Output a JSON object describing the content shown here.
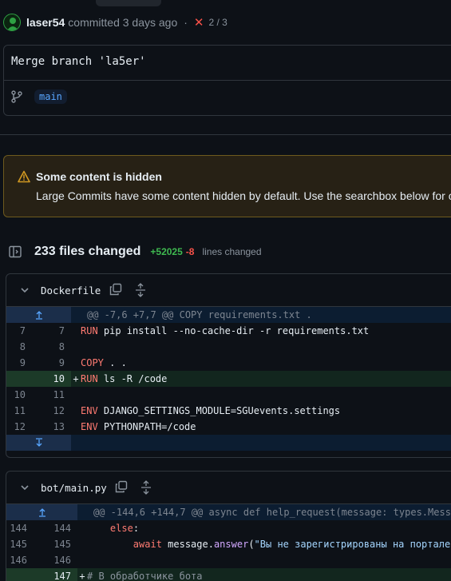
{
  "commit": {
    "author": "laser54",
    "meta": "committed 3 days ago",
    "separator": "·",
    "checks": "2 / 3",
    "message": "Merge branch 'la5er'",
    "branch": "main"
  },
  "notice": {
    "title": "Some content is hidden",
    "body": "Large Commits have some content hidden by default. Use the searchbox below for c"
  },
  "summary": {
    "files_changed": "233 files changed",
    "additions": "+52025",
    "deletions": "-8",
    "lines_changed": "lines changed"
  },
  "files": [
    {
      "name": "Dockerfile",
      "hunk": "@@ -7,6 +7,7 @@ COPY requirements.txt .",
      "lines": [
        {
          "old": "7",
          "new": "7",
          "sign": "",
          "kw": "RUN",
          "rest": " pip install --no-cache-dir -r requirements.txt"
        },
        {
          "old": "8",
          "new": "8",
          "sign": "",
          "kw": "",
          "rest": ""
        },
        {
          "old": "9",
          "new": "9",
          "sign": "",
          "kw": "COPY",
          "rest": " . ."
        },
        {
          "old": "",
          "new": "10",
          "sign": "+",
          "kw": "RUN",
          "rest": " ls -R /code"
        },
        {
          "old": "10",
          "new": "11",
          "sign": "",
          "kw": "",
          "rest": ""
        },
        {
          "old": "11",
          "new": "12",
          "sign": "",
          "kw": "ENV",
          "rest": " DJANGO_SETTINGS_MODULE=SGUevents.settings"
        },
        {
          "old": "12",
          "new": "13",
          "sign": "",
          "kw": "ENV",
          "rest": " PYTHONPATH=/code"
        }
      ]
    },
    {
      "name": "bot/main.py",
      "hunk": "@@ -144,6 +144,7 @@ async def help_request(message: types.Messa",
      "lines": [
        {
          "old": "144",
          "new": "144",
          "sign": "",
          "indent": "    ",
          "kw": "else",
          "rest": ":"
        },
        {
          "old": "145",
          "new": "145",
          "sign": "",
          "indent": "        ",
          "kw": "await",
          "rest": " message.",
          "fn": "answer",
          "rest2": "(",
          "str": "\"Вы не зарегистрированы на портале"
        },
        {
          "old": "146",
          "new": "146",
          "sign": "",
          "kw": "",
          "rest": ""
        },
        {
          "old": "",
          "new": "147",
          "sign": "+",
          "com": "# В обработчике бота"
        }
      ]
    }
  ],
  "colors": {
    "background": "#0d1117",
    "addition": "#3fb950",
    "deletion": "#f85149",
    "link": "#58a6ff",
    "warning_border": "#6e5a1e"
  }
}
